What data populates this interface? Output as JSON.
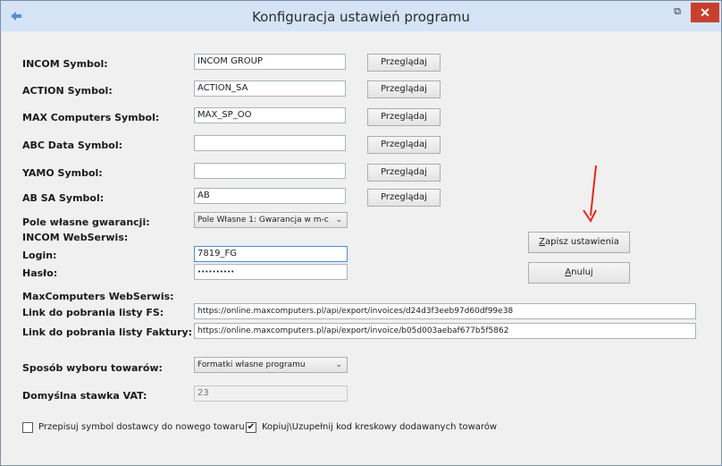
{
  "window": {
    "title": "Konfiguracja ustawień programu",
    "restore_glyph": "⧉",
    "close_glyph": "✕",
    "app_icon": "app-icon"
  },
  "form": {
    "incom_symbol": {
      "label": "INCOM Symbol:",
      "value": "INCOM GROUP",
      "browse": "Przeglądaj"
    },
    "action_symbol": {
      "label": "ACTION Symbol:",
      "value": "ACTION_SA",
      "browse": "Przeglądaj"
    },
    "max_symbol": {
      "label": "MAX Computers Symbol:",
      "value": "MAX_SP_OO",
      "browse": "Przeglądaj"
    },
    "abc_symbol": {
      "label": "ABC Data Symbol:",
      "value": "",
      "browse": "Przeglądaj"
    },
    "yamo_symbol": {
      "label": "YAMO Symbol:",
      "value": "",
      "browse": "Przeglądaj"
    },
    "ab_symbol": {
      "label": "AB SA Symbol:",
      "value": "AB",
      "browse": "Przeglądaj"
    },
    "warranty": {
      "label": "Pole własne gwarancji:",
      "selected": "Pole Własne 1: Gwarancja w m-c"
    },
    "incom_ws": {
      "heading": "INCOM WebSerwis:",
      "login_label": "Login:",
      "login_value": "7819_FG",
      "password_label": "Hasło:",
      "password_value": "••••••••••"
    },
    "maxws": {
      "heading": "MaxComputers WebSerwis:",
      "fs_label": "Link do pobrania listy FS:",
      "fs_value": "https://online.maxcomputers.pl/api/export/invoices/d24d3f3eeb97d60df99e38",
      "fakt_label": "Link do pobrania listy Faktury:",
      "fakt_value": "https://online.maxcomputers.pl/api/export/invoice/b05d003aebaf677b5f5862"
    },
    "selection": {
      "label": "Sposób wyboru towarów:",
      "selected": "Formatki własne programu"
    },
    "vat": {
      "label": "Domyślna stawka VAT:",
      "value": "23"
    },
    "checkbox1": {
      "label": "Przepisuj symbol dostawcy do nowego towaru",
      "checked": false
    },
    "checkbox2": {
      "label": "Kopiuj\\Uzupełnij kod kreskowy dodawanych towarów",
      "checked": true,
      "mark": "✔"
    }
  },
  "actions": {
    "save": {
      "accel": "Z",
      "rest": "apisz ustawienia"
    },
    "cancel": {
      "accel": "A",
      "rest": "nuluj"
    }
  },
  "annotation": {
    "color": "#e8261c"
  },
  "dropdown_glyph": "⌄"
}
